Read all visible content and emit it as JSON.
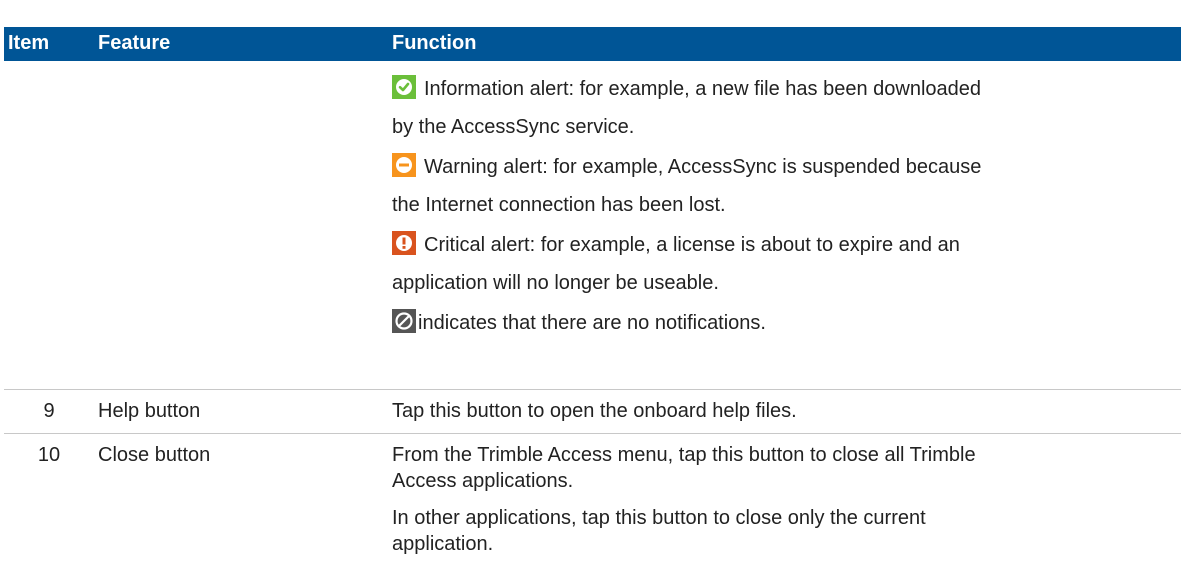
{
  "header": {
    "item": "Item",
    "feature": "Feature",
    "function": "Function"
  },
  "rows": [
    {
      "item": "",
      "feature": "",
      "alerts": [
        {
          "icon": "check-circle-icon",
          "color": "#6bbf3a",
          "line1": "Information alert: for example, a new file has been downloaded",
          "line2": "by the AccessSync service."
        },
        {
          "icon": "minus-circle-icon",
          "color": "#f7941d",
          "line1": "Warning alert: for example, AccessSync is suspended because",
          "line2": "the Internet connection has been lost."
        },
        {
          "icon": "exclamation-circle-icon",
          "color": "#d9531e",
          "line1": "Critical alert: for example, a license is about to expire and an",
          "line2": "application will no longer be useable."
        },
        {
          "icon": "no-notifications-icon",
          "color": "#555555",
          "line1": "indicates that there are no notifications."
        }
      ]
    },
    {
      "item": "9",
      "feature": "Help button",
      "function": "Tap this button to open the onboard help files."
    },
    {
      "item": "10",
      "feature": "Close button",
      "function_lines": [
        "From the Trimble Access menu, tap this button to close all Trimble",
        "Access applications.",
        "In other applications, tap this button to close only the current",
        "application."
      ]
    }
  ]
}
